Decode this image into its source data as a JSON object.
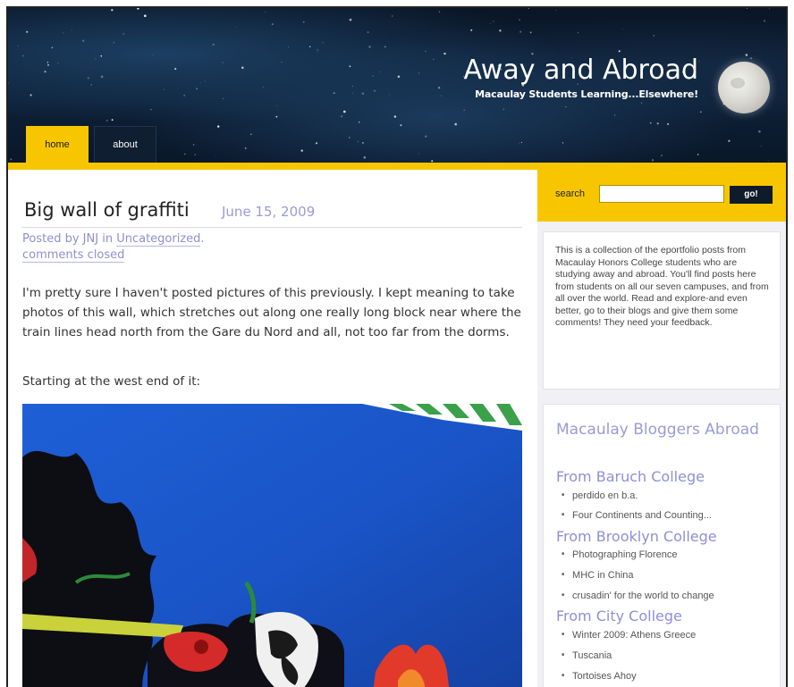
{
  "site": {
    "title": "Away and Abroad",
    "tagline": "Macaulay Students Learning...Elsewhere!"
  },
  "nav": {
    "tabs": [
      {
        "label": "home",
        "active": true
      },
      {
        "label": "about",
        "active": false
      }
    ]
  },
  "post": {
    "title": "Big wall of graffiti",
    "date": "June 15, 2009",
    "meta_prefix": "Posted by ",
    "author": "JNJ",
    "meta_in": " in ",
    "category": "Uncategorized",
    "meta_comma": ".",
    "comments": "comments closed",
    "paragraph1": "I'm pretty sure I haven't posted pictures of this previously. I kept meaning to take photos of this wall, which stretches out along one really long block near where the train lines head north from the Gare du Nord and all, not too far from the dorms.",
    "paragraph2": "Starting at the west end of it:"
  },
  "sidebar": {
    "search_label": "search",
    "search_placeholder": "",
    "search_button": "go!",
    "about_text": "This is a collection of the eportfolio posts from Macaulay Honors College students who are studying away and abroad. You'll find posts here from students on all our seven campuses, and from all over the world. Read and explore-and even better, go to their blogs and give them some comments! They need your feedback.",
    "bloggers_title": "Macaulay Bloggers Abroad",
    "colleges": [
      {
        "name": "From Baruch College",
        "blogs": [
          "perdido en b.a.",
          "Four Continents and Counting..."
        ]
      },
      {
        "name": "From Brooklyn College",
        "blogs": [
          "Photographing Florence",
          "MHC in China",
          "crusadin' for the world to change"
        ]
      },
      {
        "name": "From City College",
        "blogs": [
          "Winter 2009: Athens Greece",
          "Tuscania",
          "Tortoises Ahoy"
        ]
      }
    ]
  },
  "colors": {
    "accent_yellow": "#f7c600",
    "link_lavender": "#9b9bd6",
    "header_navy": "#0d2036"
  }
}
